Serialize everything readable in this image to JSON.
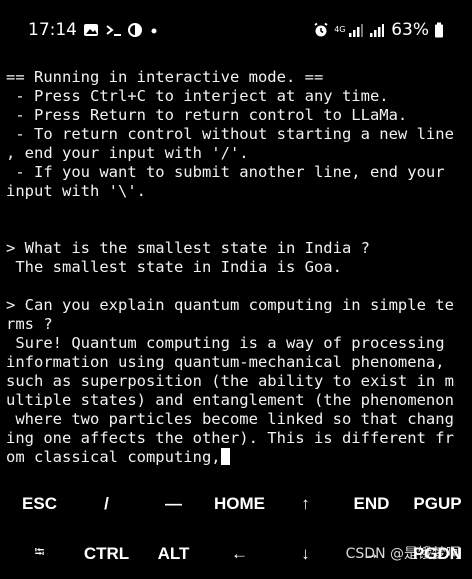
{
  "status_bar": {
    "time": "17:14",
    "left_icons": [
      "image-icon",
      "terminal-prompt-icon",
      "half-moon-icon",
      "dot-icon"
    ],
    "network_label": "4G",
    "battery": "63%",
    "right_icons": [
      "alarm-icon",
      "signal-icon",
      "signal-icon",
      "battery-icon"
    ]
  },
  "terminal": {
    "lines": [
      "== Running in interactive mode. ==",
      " - Press Ctrl+C to interject at any time.",
      " - Press Return to return control to LLaMa.",
      " - To return control without starting a new line",
      ", end your input with '/'.",
      " - If you want to submit another line, end your",
      "input with '\\'.",
      "",
      "",
      "> What is the smallest state in India ?",
      " The smallest state in India is Goa.",
      "",
      "> Can you explain quantum computing in simple te",
      "rms ?",
      " Sure! Quantum computing is a way of processing",
      "information using quantum-mechanical phenomena,",
      "such as superposition (the ability to exist in m",
      "ultiple states) and entanglement (the phenomenon",
      " where two particles become linked so that chang",
      "ing one affects the other). This is different fr",
      "om classical computing,"
    ]
  },
  "extra_keys": {
    "row1": [
      "ESC",
      "/",
      "—",
      "HOME",
      "↑",
      "END",
      "PGUP"
    ],
    "row2": [
      "⭾",
      "CTRL",
      "ALT",
      "←",
      "↓",
      "→",
      "PGDN"
    ]
  },
  "watermark": "CSDN @是饿梦啊"
}
